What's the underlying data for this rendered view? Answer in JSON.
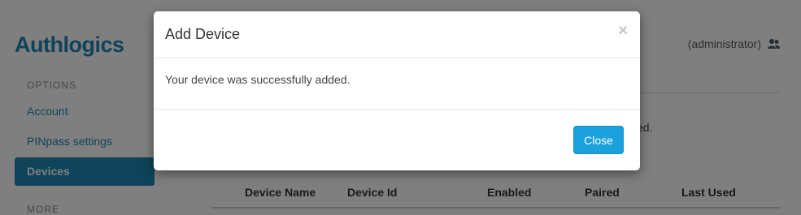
{
  "app": {
    "logo": "Authlogics"
  },
  "sidebar": {
    "options_heading": "OPTIONS",
    "items": [
      {
        "label": "Account"
      },
      {
        "label": "PINpass settings"
      },
      {
        "label": "Devices",
        "active": true
      }
    ],
    "more_heading": "MORE"
  },
  "header": {
    "user_label": "(administrator)",
    "user_icon": "users-icon"
  },
  "main": {
    "partial_text": "ed.",
    "table": {
      "columns": [
        "Device Name",
        "Device Id",
        "Enabled",
        "Paired",
        "Last Used"
      ]
    }
  },
  "modal": {
    "title": "Add Device",
    "close_symbol": "×",
    "message": "Your device was successfully added.",
    "close_button_label": "Close"
  },
  "colors": {
    "brand": "#1f86b3",
    "button_primary": "#1ba1dc",
    "backdrop": "rgba(0,0,0,0.5)"
  }
}
